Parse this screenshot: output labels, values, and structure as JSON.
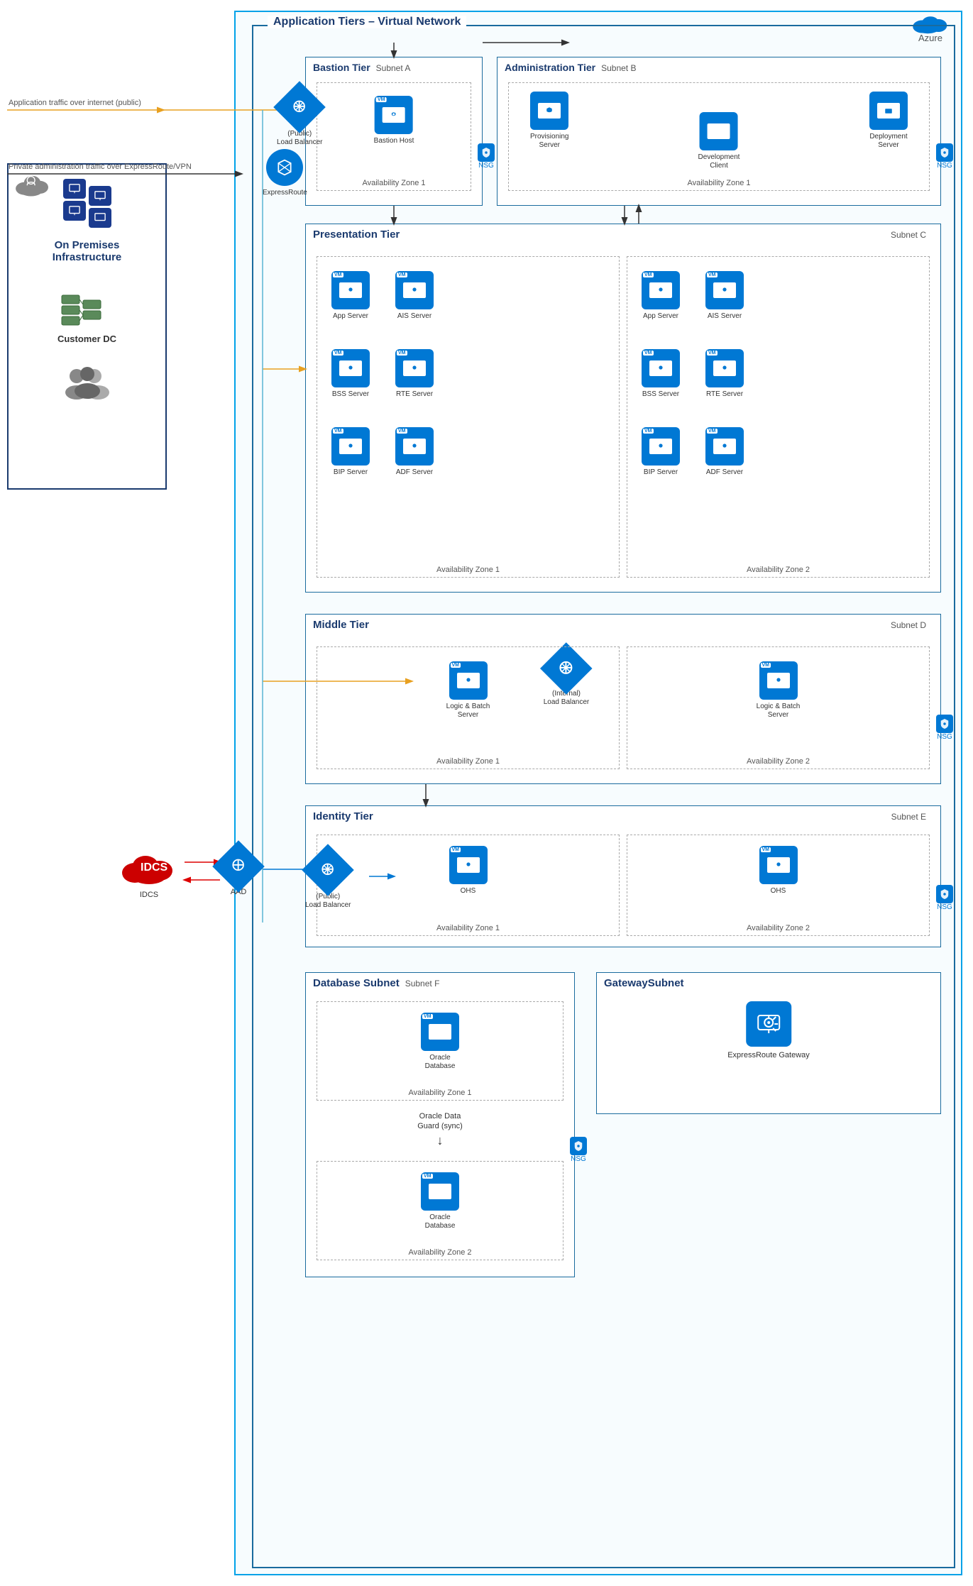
{
  "azure_label": "Azure",
  "vnet_title": "Application Tiers – Virtual Network",
  "on_premises": {
    "title": "On Premises\nInfrastructure",
    "customer_dc": "Customer DC"
  },
  "bastion_tier": {
    "title": "Bastion Tier",
    "subnet": "Subnet A",
    "bastion_host": "Bastion Host",
    "zone": "Availability Zone 1",
    "nsg": "NSG"
  },
  "admin_tier": {
    "title": "Administration Tier",
    "subnet": "Subnet B",
    "provisioning_server": "Provisioning\nServer",
    "deployment_server": "Deployment\nServer",
    "development_client": "Development\nClient",
    "zone": "Availability Zone 1",
    "nsg": "NSG"
  },
  "presentation_tier": {
    "title": "Presentation Tier",
    "subnet": "Subnet C",
    "zone1": "Availability Zone 1",
    "zone2": "Availability Zone 2",
    "servers_z1": [
      "App Server",
      "AIS Server",
      "BSS Server",
      "RTE Server",
      "BIP Server",
      "ADF Server"
    ],
    "servers_z2": [
      "App Server",
      "AIS Server",
      "BSS Server",
      "RTE Server",
      "BIP Server",
      "ADF Server"
    ]
  },
  "middle_tier": {
    "title": "Middle Tier",
    "subnet": "Subnet D",
    "zone1": "Availability Zone 1",
    "zone2": "Availability Zone 2",
    "internal_lb": "(Internal)\nLoad Balancer",
    "server": "Logic & Batch Server",
    "nsg": "NSG"
  },
  "identity_tier": {
    "title": "Identity Tier",
    "subnet": "Subnet E",
    "zone1": "Availability Zone 1",
    "zone2": "Availability Zone 2",
    "ohs": "OHS",
    "public_lb": "(Public)\nLoad Balancer",
    "nsg": "NSG",
    "idcs": "IDCS",
    "aad": "AAD"
  },
  "database_tier": {
    "title": "Database Subnet",
    "subnet": "Subnet F",
    "zone1": "Availability Zone 1",
    "zone2": "Availability Zone 2",
    "oracle_db": "Oracle Database",
    "sync_label": "Oracle Data\nGuard (sync)",
    "nsg": "NSG"
  },
  "gateway_subnet": {
    "title": "GatewaySubnet",
    "expressroute_gateway": "ExpressRoute Gateway"
  },
  "public_lb_label": "(Public)\nLoad Balancer",
  "expressroute_label": "ExpressRoute",
  "traffic_label": "Application traffic over internet (public)",
  "private_admin_label": "Private administration traffic over ExpressRoute/VPN"
}
